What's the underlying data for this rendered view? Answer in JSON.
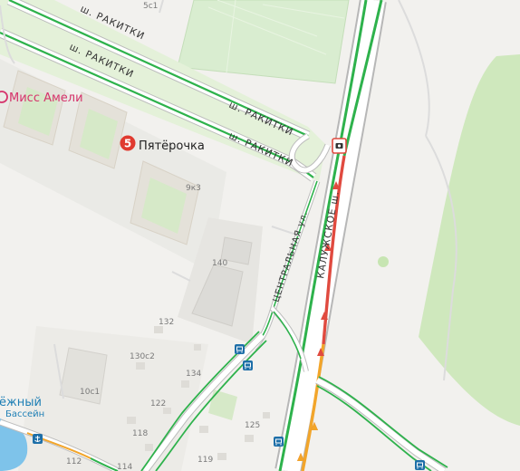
{
  "map": {
    "roads": [
      {
        "id": "rakitki-1",
        "name": "ш. РАКИТКИ"
      },
      {
        "id": "rakitki-2",
        "name": "ш. РАКИТКИ"
      },
      {
        "id": "rakitki-3",
        "name": "ш. РАКИТКИ"
      },
      {
        "id": "rakitki-4",
        "name": "ш. РАКИТКИ"
      },
      {
        "id": "kaluzhskoe",
        "name": "КАЛУЖСКОЕ ш."
      },
      {
        "id": "centralnaya",
        "name": "ЦЕНТРАЛЬНАЯ ул."
      }
    ],
    "pois": [
      {
        "id": "miss-ameli",
        "name": "Мисс Амели",
        "color": "#d6336c"
      },
      {
        "id": "pyaterochka",
        "name": "Пятёрочка",
        "badge": "5",
        "color": "#e03a2f"
      },
      {
        "id": "basseyn",
        "name_partial": "ёжный",
        "name": "Бассейн",
        "color": "#1e7fb5"
      }
    ],
    "house_numbers": [
      {
        "id": "h-5c1",
        "text": "5с1"
      },
      {
        "id": "h-9k3",
        "text": "9к3"
      },
      {
        "id": "h-140",
        "text": "140"
      },
      {
        "id": "h-132",
        "text": "132"
      },
      {
        "id": "h-130c2",
        "text": "130с2"
      },
      {
        "id": "h-134",
        "text": "134"
      },
      {
        "id": "h-10c1",
        "text": "10с1"
      },
      {
        "id": "h-122",
        "text": "122"
      },
      {
        "id": "h-118",
        "text": "118"
      },
      {
        "id": "h-125",
        "text": "125"
      },
      {
        "id": "h-112",
        "text": "112"
      },
      {
        "id": "h-114",
        "text": "114"
      },
      {
        "id": "h-119",
        "text": "119"
      }
    ],
    "colors": {
      "background": "#f2f1ee",
      "park": "#cfe8bd",
      "traffic_free": "#2eb24c",
      "traffic_jam": "#e04a3f",
      "traffic_slow": "#f2a52a",
      "road": "#ffffff",
      "road_casing": "#b9b9b9",
      "water": "#7ec3ea"
    },
    "icons": [
      "bus-stop-icon",
      "bus-stop-icon",
      "bus-stop-icon",
      "anchor-icon",
      "camera-sign-icon"
    ]
  }
}
